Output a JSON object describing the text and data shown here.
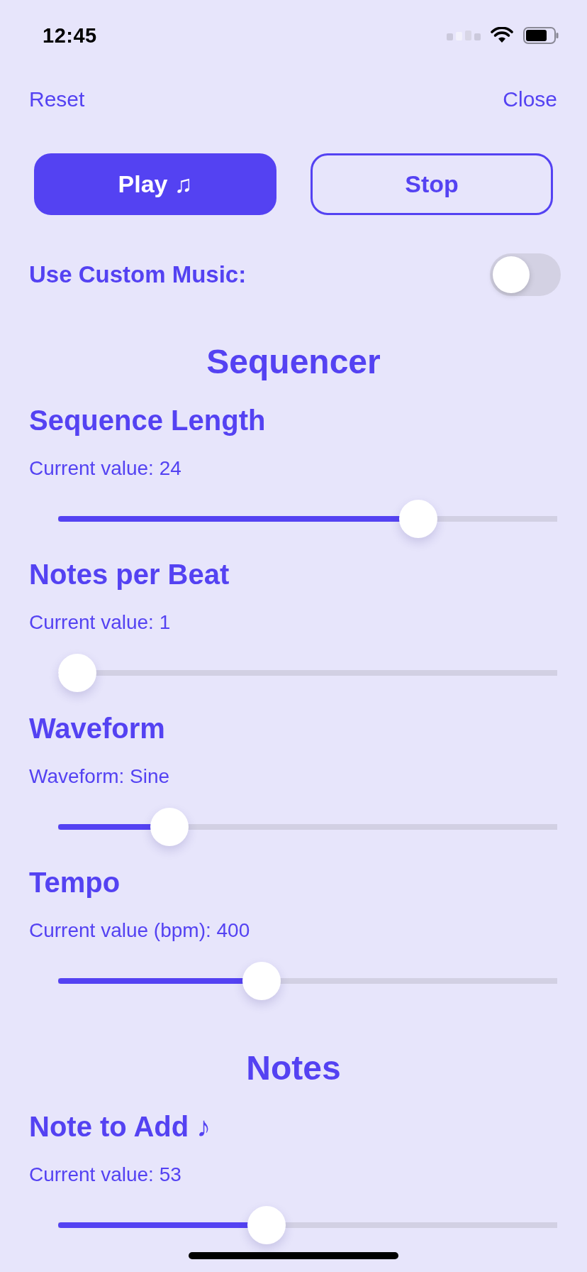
{
  "status_bar": {
    "time": "12:45"
  },
  "nav": {
    "left": "Reset",
    "right": "Close"
  },
  "buttons": [
    {
      "label": "Play ♫",
      "kind": "filled"
    },
    {
      "label": "Stop",
      "kind": "outline"
    }
  ],
  "custom_music": {
    "label": "Use Custom Music:",
    "on": false
  },
  "sections": [
    {
      "title": "Sequencer",
      "controls": [
        {
          "title": "Sequence Length",
          "reading": "Current value: 24",
          "level": 0.74
        },
        {
          "title": "Notes per Beat",
          "reading": "Current value: 1",
          "level": 0
        },
        {
          "title": "Waveform",
          "reading": "Waveform: Sine",
          "level": 0.2
        },
        {
          "title": "Tempo",
          "reading": "Current value (bpm): 400",
          "level": 0.4
        }
      ]
    },
    {
      "title": "Notes",
      "controls": [
        {
          "title": "Note to Add ♪",
          "reading": "Current value: 53",
          "level": 0.41
        }
      ]
    }
  ]
}
